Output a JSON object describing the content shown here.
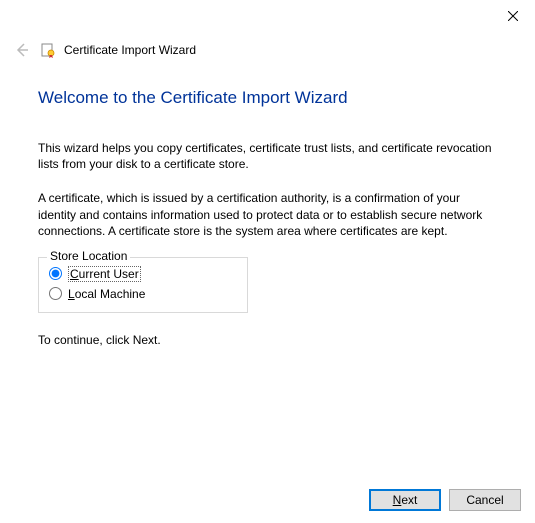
{
  "titlebar": {
    "close_tooltip": "Close"
  },
  "header": {
    "wizard_title": "Certificate Import Wizard"
  },
  "main": {
    "heading": "Welcome to the Certificate Import Wizard",
    "para1": "This wizard helps you copy certificates, certificate trust lists, and certificate revocation lists from your disk to a certificate store.",
    "para2": "A certificate, which is issued by a certification authority, is a confirmation of your identity and contains information used to protect data or to establish secure network connections. A certificate store is the system area where certificates are kept.",
    "store_location": {
      "legend": "Store Location",
      "options": {
        "current_user": {
          "accel": "C",
          "rest": "urrent User",
          "selected": true
        },
        "local_machine": {
          "accel": "L",
          "rest": "ocal Machine",
          "selected": false
        }
      }
    },
    "continue_text": "To continue, click Next."
  },
  "footer": {
    "next": {
      "accel": "N",
      "rest": "ext"
    },
    "cancel_label": "Cancel"
  }
}
